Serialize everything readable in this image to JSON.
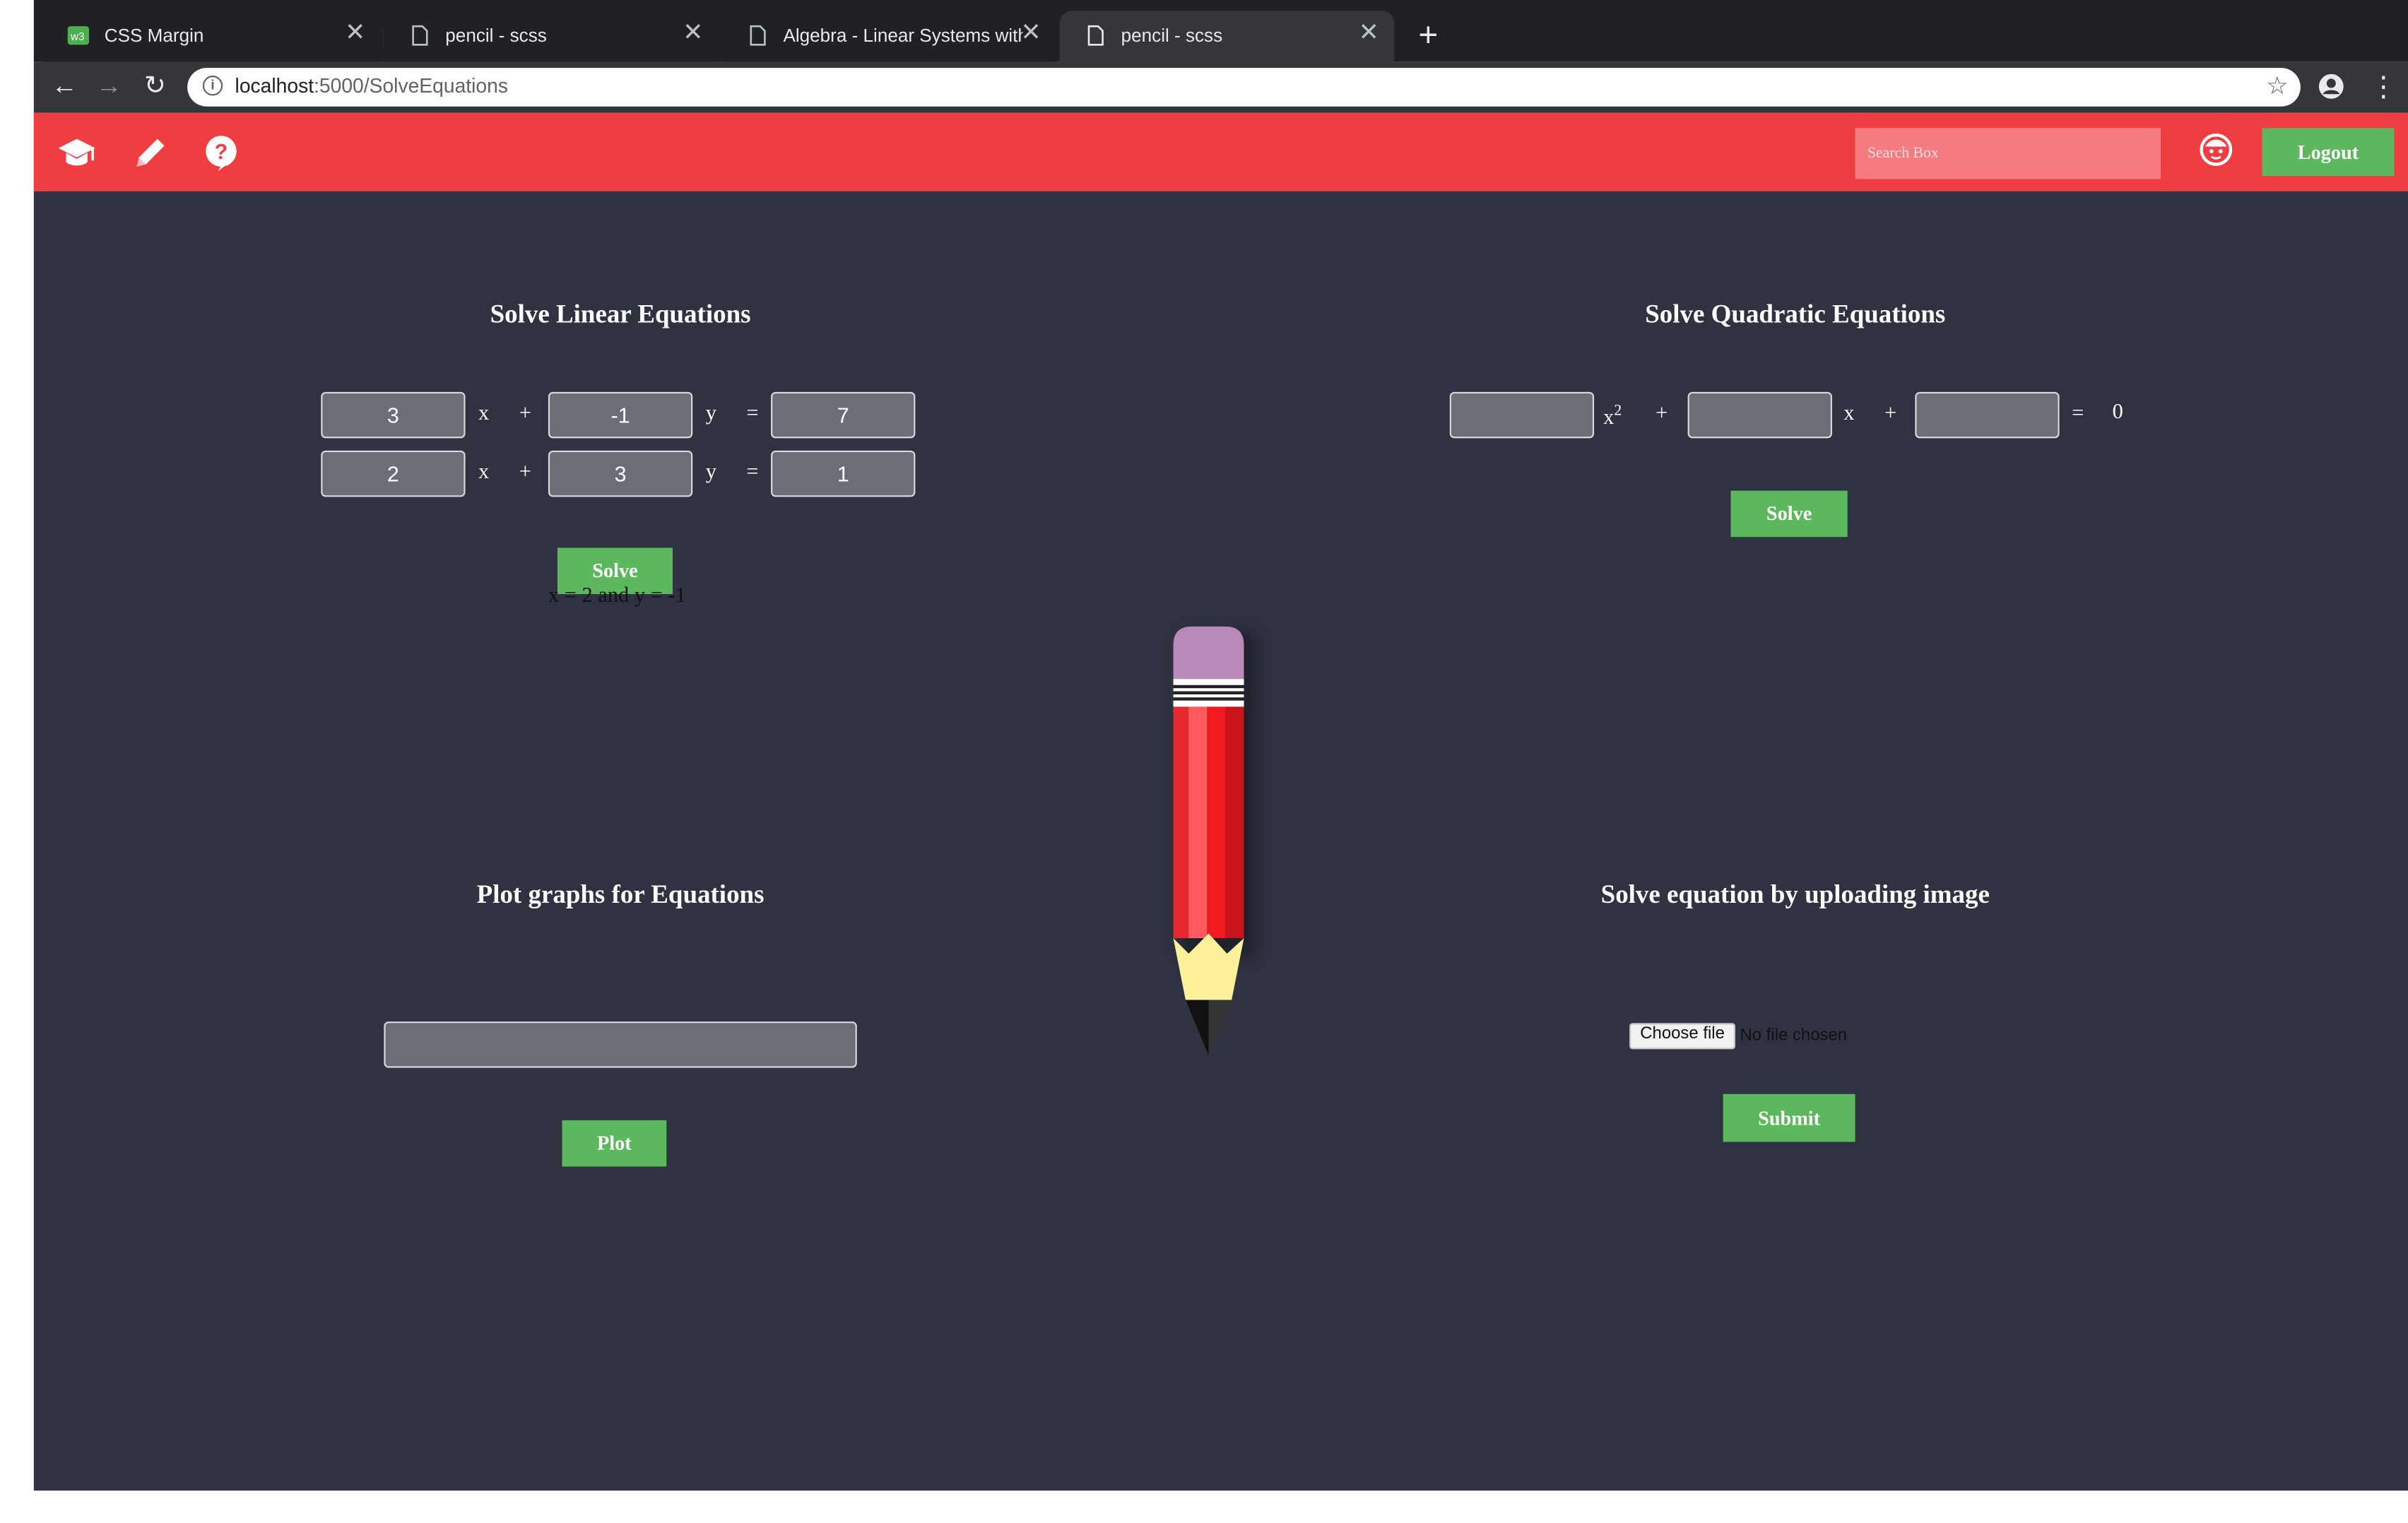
{
  "browser": {
    "tabs": [
      {
        "label": "CSS Margin",
        "icon": "w3-favicon-icon"
      },
      {
        "label": "pencil - scss",
        "icon": "page-icon"
      },
      {
        "label": "Algebra - Linear Systems with",
        "icon": "page-icon"
      },
      {
        "label": "pencil - scss",
        "icon": "page-icon"
      }
    ],
    "address_host": "localhost",
    "address_path": ":5000/SolveEquations"
  },
  "navbar": {
    "search_placeholder": "Search Box",
    "logout_label": "Logout"
  },
  "linear": {
    "title": "Solve Linear Equations",
    "rows": [
      {
        "a": "3",
        "b": "-1",
        "c": "7"
      },
      {
        "a": "2",
        "b": "3",
        "c": "1"
      }
    ],
    "x_label": "x",
    "y_label": "y",
    "plus": "+",
    "equals": "=",
    "solve_label": "Solve",
    "result": "x = 2 and y = -1"
  },
  "quadratic": {
    "title": "Solve Quadratic Equations",
    "x_label": "x",
    "exponent": "2",
    "plus": "+",
    "equals": "=",
    "zero": "0",
    "solve_label": "Solve"
  },
  "plot": {
    "title": "Plot graphs for Equations",
    "plot_label": "Plot"
  },
  "upload": {
    "title": "Solve equation by uploading image",
    "choose_label": "Choose file",
    "no_file": "No file chosen",
    "submit_label": "Submit"
  },
  "colors": {
    "navbar": "#ef3e42",
    "background": "#2f3241",
    "button": "#5cb85c"
  }
}
